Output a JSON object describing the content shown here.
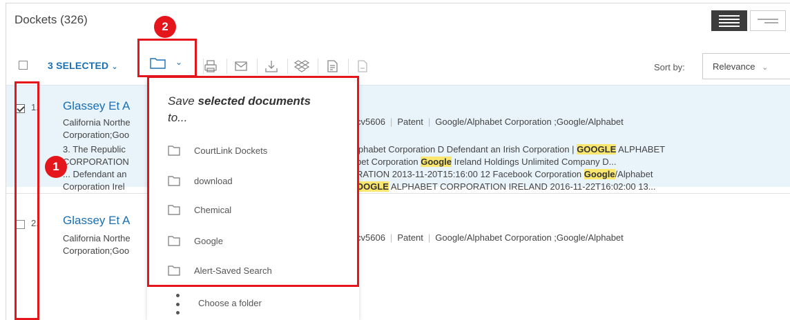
{
  "header": {
    "title": "Dockets (326)"
  },
  "toolbar": {
    "selected_label": "3 SELECTED",
    "sort_label": "Sort by:",
    "sort_value": "Relevance"
  },
  "results": [
    {
      "num": "1.",
      "title": "Glassey Et A",
      "meta_left_1": "California Northe",
      "meta_left_2": "Corporation;Goo",
      "meta_right": {
        "case": "cv5606",
        "type": "Patent",
        "parties": "Google/Alphabet Corporation ;Google/Alphabet"
      },
      "snippet_left": [
        "3. The Republic",
        "CORPORATION",
        "... Defendant an",
        "Corporation Irel"
      ],
      "snippet_right": [
        {
          "pre": "lphabet Corporation D Defendant an Irish Corporation | ",
          "hl": "GOOGLE",
          "post": " ALPHABET"
        },
        {
          "pre": "bet Corporation ",
          "hl": "Google",
          "post": " Ireland Holdings Unlimited Company D..."
        },
        {
          "pre": "RATION 2013-11-20T15:16:00 12 Facebook Corporation ",
          "hl": "Google",
          "post": "/Alphabet"
        },
        {
          "pre": "",
          "hl": "OOGLE",
          "post": " ALPHABET CORPORATION IRELAND 2016-11-22T16:02:00 13..."
        }
      ],
      "checked": true
    },
    {
      "num": "2.",
      "title": "Glassey Et A",
      "meta_left_1": "California Northe",
      "meta_left_2": "Corporation;Goo",
      "meta_right": {
        "case": "cv5606",
        "type": "Patent",
        "parties": "Google/Alphabet Corporation ;Google/Alphabet"
      },
      "checked": false
    }
  ],
  "dropdown": {
    "heading_plain": "Save ",
    "heading_bold": "selected documents",
    "heading_tail": "to...",
    "folders": [
      "CourtLink Dockets",
      "download",
      "Chemical",
      "Google",
      "Alert-Saved Search"
    ],
    "footer": "Choose a folder"
  },
  "annotations": {
    "badge_1": "1",
    "badge_2": "2"
  },
  "colors": {
    "accent": "#1a6fb3",
    "highlight_box": "#e4151b",
    "selected_row": "#e8f3fa",
    "search_hit": "#fbe76e"
  },
  "icons": [
    "folder-icon",
    "print-icon",
    "email-icon",
    "download-icon",
    "dropbox-icon",
    "copy-doc-icon",
    "document-icon"
  ]
}
